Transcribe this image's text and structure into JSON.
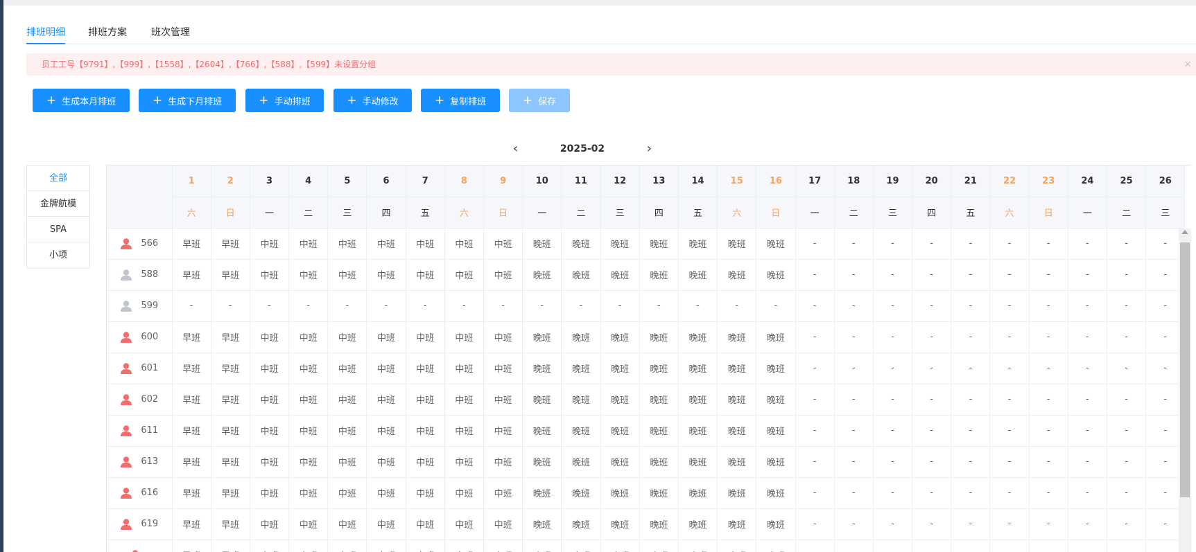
{
  "tabs": [
    {
      "label": "排班明细",
      "active": true
    },
    {
      "label": "排班方案",
      "active": false
    },
    {
      "label": "班次管理",
      "active": false
    }
  ],
  "alert": {
    "text": "员工工号【9791】,【999】,【1558】,【2604】,【766】,【588】,【599】未设置分组",
    "close": "×"
  },
  "toolbar": {
    "buttons": [
      {
        "label": "生成本月排班",
        "disabled": false
      },
      {
        "label": "生成下月排班",
        "disabled": false
      },
      {
        "label": "手动排班",
        "disabled": false
      },
      {
        "label": "手动修改",
        "disabled": false
      },
      {
        "label": "复制排班",
        "disabled": false
      },
      {
        "label": "保存",
        "disabled": true
      }
    ]
  },
  "month_nav": {
    "prev": "‹",
    "label": "2025-02",
    "next": "›"
  },
  "groups": [
    {
      "label": "全部",
      "active": true
    },
    {
      "label": "金牌航模",
      "active": false
    },
    {
      "label": "SPA",
      "active": false
    },
    {
      "label": "小项",
      "active": false
    }
  ],
  "colors": {
    "accent": "#1890ff",
    "weekend": "#f7a35c",
    "person_active": "#f56c6c",
    "person_inactive": "#c0c4cc"
  },
  "schedule": {
    "days": [
      "1",
      "2",
      "3",
      "4",
      "5",
      "6",
      "7",
      "8",
      "9",
      "10",
      "11",
      "12",
      "13",
      "14",
      "15",
      "16",
      "17",
      "18",
      "19",
      "20",
      "21",
      "22",
      "23",
      "24",
      "25",
      "26"
    ],
    "weekdays": [
      "六",
      "日",
      "一",
      "二",
      "三",
      "四",
      "五",
      "六",
      "日",
      "一",
      "二",
      "三",
      "四",
      "五",
      "六",
      "日",
      "一",
      "二",
      "三",
      "四",
      "五",
      "六",
      "日",
      "一",
      "二",
      "三"
    ],
    "weekend_flags": [
      true,
      true,
      false,
      false,
      false,
      false,
      false,
      true,
      true,
      false,
      false,
      false,
      false,
      false,
      true,
      true,
      false,
      false,
      false,
      false,
      false,
      true,
      true,
      false,
      false,
      false
    ],
    "rows": [
      {
        "id": "566",
        "active": true,
        "shifts": [
          "早班",
          "早班",
          "中班",
          "中班",
          "中班",
          "中班",
          "中班",
          "中班",
          "中班",
          "晚班",
          "晚班",
          "晚班",
          "晚班",
          "晚班",
          "晚班",
          "晚班",
          "-",
          "-",
          "-",
          "-",
          "-",
          "-",
          "-",
          "-",
          "-",
          "-"
        ]
      },
      {
        "id": "588",
        "active": false,
        "shifts": [
          "早班",
          "早班",
          "中班",
          "中班",
          "中班",
          "中班",
          "中班",
          "中班",
          "中班",
          "晚班",
          "晚班",
          "晚班",
          "晚班",
          "晚班",
          "晚班",
          "晚班",
          "-",
          "-",
          "-",
          "-",
          "-",
          "-",
          "-",
          "-",
          "-",
          "-"
        ]
      },
      {
        "id": "599",
        "active": false,
        "shifts": [
          "-",
          "-",
          "-",
          "-",
          "-",
          "-",
          "-",
          "-",
          "-",
          "-",
          "-",
          "-",
          "-",
          "-",
          "-",
          "-",
          "-",
          "-",
          "-",
          "-",
          "-",
          "-",
          "-",
          "-",
          "-",
          "-"
        ]
      },
      {
        "id": "600",
        "active": true,
        "shifts": [
          "早班",
          "早班",
          "中班",
          "中班",
          "中班",
          "中班",
          "中班",
          "中班",
          "中班",
          "晚班",
          "晚班",
          "晚班",
          "晚班",
          "晚班",
          "晚班",
          "晚班",
          "-",
          "-",
          "-",
          "-",
          "-",
          "-",
          "-",
          "-",
          "-",
          "-"
        ]
      },
      {
        "id": "601",
        "active": true,
        "shifts": [
          "早班",
          "早班",
          "中班",
          "中班",
          "中班",
          "中班",
          "中班",
          "中班",
          "中班",
          "晚班",
          "晚班",
          "晚班",
          "晚班",
          "晚班",
          "晚班",
          "晚班",
          "-",
          "-",
          "-",
          "-",
          "-",
          "-",
          "-",
          "-",
          "-",
          "-"
        ]
      },
      {
        "id": "602",
        "active": true,
        "shifts": [
          "早班",
          "早班",
          "中班",
          "中班",
          "中班",
          "中班",
          "中班",
          "中班",
          "中班",
          "晚班",
          "晚班",
          "晚班",
          "晚班",
          "晚班",
          "晚班",
          "晚班",
          "-",
          "-",
          "-",
          "-",
          "-",
          "-",
          "-",
          "-",
          "-",
          "-"
        ]
      },
      {
        "id": "611",
        "active": true,
        "shifts": [
          "早班",
          "早班",
          "中班",
          "中班",
          "中班",
          "中班",
          "中班",
          "中班",
          "中班",
          "晚班",
          "晚班",
          "晚班",
          "晚班",
          "晚班",
          "晚班",
          "晚班",
          "-",
          "-",
          "-",
          "-",
          "-",
          "-",
          "-",
          "-",
          "-",
          "-"
        ]
      },
      {
        "id": "613",
        "active": true,
        "shifts": [
          "早班",
          "早班",
          "中班",
          "中班",
          "中班",
          "中班",
          "中班",
          "中班",
          "中班",
          "晚班",
          "晚班",
          "晚班",
          "晚班",
          "晚班",
          "晚班",
          "晚班",
          "-",
          "-",
          "-",
          "-",
          "-",
          "-",
          "-",
          "-",
          "-",
          "-"
        ]
      },
      {
        "id": "616",
        "active": true,
        "shifts": [
          "早班",
          "早班",
          "中班",
          "中班",
          "中班",
          "中班",
          "中班",
          "中班",
          "中班",
          "晚班",
          "晚班",
          "晚班",
          "晚班",
          "晚班",
          "晚班",
          "晚班",
          "-",
          "-",
          "-",
          "-",
          "-",
          "-",
          "-",
          "-",
          "-",
          "-"
        ]
      },
      {
        "id": "619",
        "active": true,
        "shifts": [
          "早班",
          "早班",
          "中班",
          "中班",
          "中班",
          "中班",
          "中班",
          "中班",
          "中班",
          "晚班",
          "晚班",
          "晚班",
          "晚班",
          "晚班",
          "晚班",
          "晚班",
          "-",
          "-",
          "-",
          "-",
          "-",
          "-",
          "-",
          "-",
          "-",
          "-"
        ]
      },
      {
        "id": "",
        "active": true,
        "shifts": [
          "早班",
          "早班",
          "中班",
          "中班",
          "中班",
          "中班",
          "中班",
          "中班",
          "中班",
          "晚班",
          "晚班",
          "晚班",
          "晚班",
          "晚班",
          "晚班",
          "晚班",
          "-",
          "-",
          "-",
          "-",
          "-",
          "-",
          "-",
          "-",
          "-",
          "-"
        ]
      }
    ]
  }
}
